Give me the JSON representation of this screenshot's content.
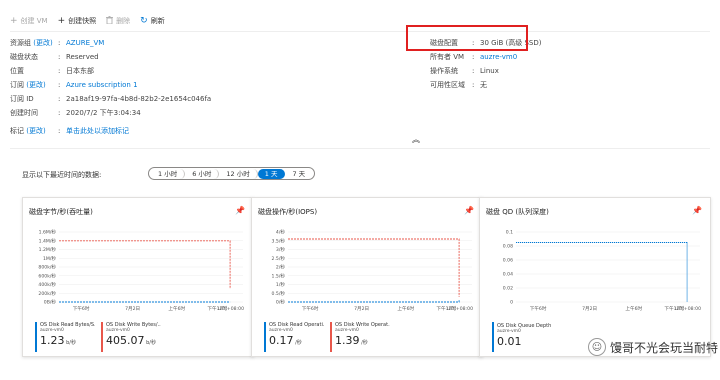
{
  "toolbar": {
    "create_vm": "创建 VM",
    "create_snapshot": "创建快照",
    "delete": "删除",
    "refresh": "刷新"
  },
  "essentials": {
    "change": "(更改)",
    "left": [
      {
        "label": "资源组",
        "has_change": true,
        "value": "AZURE_VM",
        "link": true
      },
      {
        "label": "磁盘状态",
        "has_change": false,
        "value": "Reserved",
        "link": false
      },
      {
        "label": "位置",
        "has_change": false,
        "value": "日本东部",
        "link": false
      },
      {
        "label": "订阅",
        "has_change": true,
        "value": "Azure subscription 1",
        "link": true
      },
      {
        "label": "订阅 ID",
        "has_change": false,
        "value": "2a18af19-97fa-4b8d-82b2-2e1654c046fa",
        "link": false
      },
      {
        "label": "创建时间",
        "has_change": false,
        "value": "2020/7/2 下午3:04:34",
        "link": false
      },
      {
        "label": "标记",
        "has_change": true,
        "value": "单击此处以添加标记",
        "link": true
      }
    ],
    "right": [
      {
        "label": "磁盘配置",
        "value": "30 GiB (高级 SSD)",
        "link": false
      },
      {
        "label": "所有者 VM",
        "value": "auzre-vm0",
        "link": true
      },
      {
        "label": "操作系统",
        "value": "Linux",
        "link": false
      },
      {
        "label": "可用性区域",
        "value": "无",
        "link": false
      }
    ]
  },
  "time_range": {
    "label": "显示以下最近时间的数据:",
    "options": [
      "1 小时",
      "6 小时",
      "12 小时",
      "1 天",
      "7 天"
    ],
    "selected": "1 天"
  },
  "charts": [
    {
      "title": "磁盘字节/秒(吞吐量)",
      "y_ticks": [
        "1.6M/秒",
        "1.4M/秒",
        "1.2M/秒",
        "1M/秒",
        "800k/秒",
        "600k/秒",
        "400k/秒",
        "200k/秒",
        "0B/秒"
      ],
      "x_ticks": [
        "下午6时",
        "7月2日",
        "上午6时",
        "下午12时",
        "UTC+08:00"
      ],
      "legend": [
        {
          "name": "OS Disk Read Bytes/S...",
          "sub": "auzre-vm0",
          "value": "1.23",
          "unit": "b/秒",
          "color": "#0078d4"
        },
        {
          "name": "OS Disk Write Bytes/...",
          "sub": "auzre-vm0",
          "value": "405.07",
          "unit": "b/秒",
          "color": "#e8574b"
        }
      ]
    },
    {
      "title": "磁盘操作/秒(IOPS)",
      "y_ticks": [
        "4/秒",
        "3.5/秒",
        "3/秒",
        "2.5/秒",
        "2/秒",
        "1.5/秒",
        "1/秒",
        "0.5/秒",
        "0/秒"
      ],
      "x_ticks": [
        "下午6时",
        "7月2日",
        "上午6时",
        "下午12时",
        "UTC+08:00"
      ],
      "legend": [
        {
          "name": "OS Disk Read Operati...",
          "sub": "auzre-vm0",
          "value": "0.17",
          "unit": "/秒",
          "color": "#0078d4"
        },
        {
          "name": "OS Disk Write Operat...",
          "sub": "auzre-vm0",
          "value": "1.39",
          "unit": "/秒",
          "color": "#e8574b"
        }
      ]
    },
    {
      "title": "磁盘 QD (队列深度)",
      "y_ticks": [
        "0.1",
        "0.08",
        "0.06",
        "0.04",
        "0.02",
        "0"
      ],
      "x_ticks": [
        "下午6时",
        "7月2日",
        "上午6时",
        "下午12时",
        "UTC+08:00"
      ],
      "legend": [
        {
          "name": "OS Disk Queue Depth (Preview) (平均值)",
          "sub": "auzre-vm0",
          "value": "0.01",
          "unit": "",
          "color": "#0078d4"
        }
      ]
    }
  ],
  "chart_data": [
    {
      "type": "line",
      "title": "磁盘字节/秒(吞吐量)",
      "x": [
        "下午6时",
        "7月2日",
        "上午6时",
        "下午12时"
      ],
      "series": [
        {
          "name": "OS Disk Read Bytes/S...",
          "values": [
            0,
            0,
            0,
            0,
            0
          ]
        },
        {
          "name": "OS Disk Write Bytes/...",
          "values": [
            1400000,
            1400000,
            1400000,
            1400000,
            300000
          ]
        }
      ],
      "ylim": [
        0,
        1600000
      ]
    },
    {
      "type": "line",
      "title": "磁盘操作/秒(IOPS)",
      "x": [
        "下午6时",
        "7月2日",
        "上午6时",
        "下午12时"
      ],
      "series": [
        {
          "name": "OS Disk Read Operati...",
          "values": [
            0,
            0,
            0,
            0,
            0.1
          ]
        },
        {
          "name": "OS Disk Write Operat...",
          "values": [
            3.6,
            3.6,
            3.6,
            3.6,
            0.3
          ]
        }
      ],
      "ylim": [
        0,
        4
      ]
    },
    {
      "type": "line",
      "title": "磁盘 QD (队列深度)",
      "x": [
        "下午6时",
        "7月2日",
        "上午6时",
        "下午12时"
      ],
      "series": [
        {
          "name": "OS Disk Queue Depth (Preview) (平均值)",
          "values": [
            0.085,
            0.085,
            0.085,
            0.085,
            0
          ]
        }
      ],
      "ylim": [
        0,
        0.1
      ]
    }
  ],
  "watermark": {
    "text": "馒哥不光会玩当耐特"
  }
}
